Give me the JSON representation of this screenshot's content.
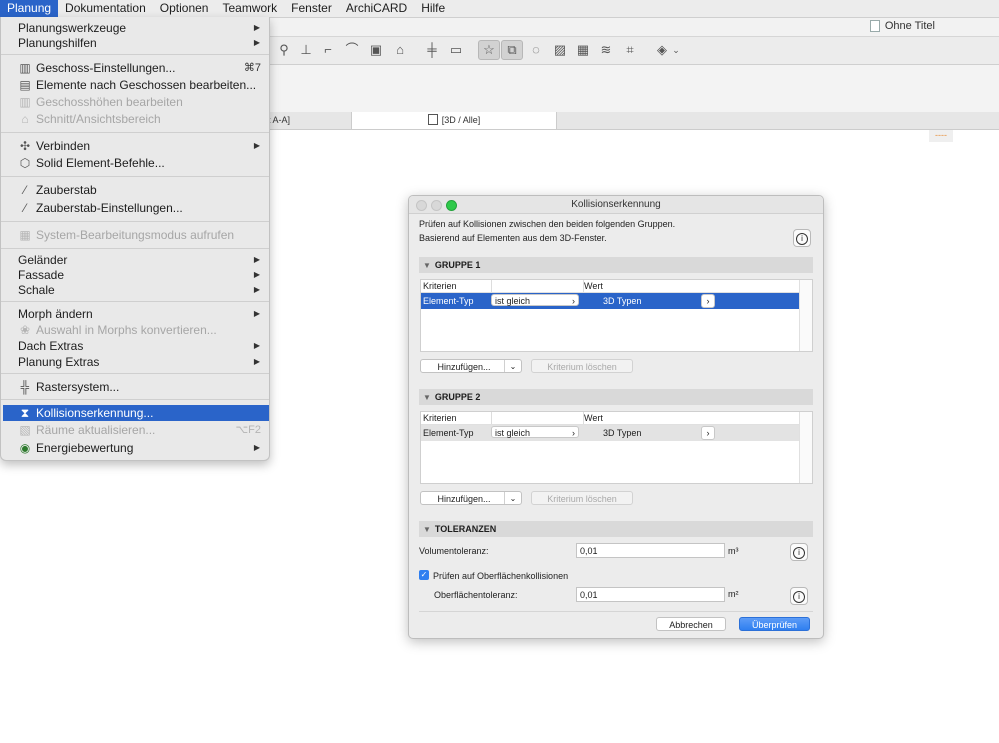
{
  "menubar": {
    "items": [
      "Planung",
      "Dokumentation",
      "Optionen",
      "Teamwork",
      "Fenster",
      "ArchiCARD",
      "Hilfe"
    ],
    "active": "Planung"
  },
  "window": {
    "doc_title": "Ohne Titel"
  },
  "tabs": {
    "inactive": "t A-A]",
    "active": "[3D / Alle]"
  },
  "misc": {
    "orange_dashes": "----"
  },
  "menu": {
    "items": [
      {
        "label": "Planungswerkzeuge",
        "submenu": true
      },
      {
        "label": "Planungshilfen",
        "submenu": true
      },
      {
        "label": "Geschoss-Einstellungen...",
        "shortcut": "⌘7",
        "icon": "building-icon"
      },
      {
        "label": "Elemente nach Geschossen bearbeiten...",
        "icon": "stack-icon"
      },
      {
        "label": "Geschosshöhen bearbeiten",
        "disabled": true,
        "icon": "story-height-icon"
      },
      {
        "label": "Schnitt/Ansichtsbereich",
        "disabled": true,
        "icon": "section-icon"
      },
      {
        "label": "Verbinden",
        "submenu": true,
        "icon": "connect-icon"
      },
      {
        "label": "Solid Element-Befehle...",
        "icon": "solid-icon"
      },
      {
        "label": "Zauberstab",
        "icon": "magic-wand-icon"
      },
      {
        "label": "Zauberstab-Einstellungen...",
        "icon": "magic-wand-settings-icon"
      },
      {
        "label": "System-Bearbeitungsmodus aufrufen",
        "disabled": true,
        "icon": "grid-system-icon"
      },
      {
        "label": "Geländer",
        "submenu": true
      },
      {
        "label": "Fassade",
        "submenu": true
      },
      {
        "label": "Schale",
        "submenu": true
      },
      {
        "label": "Morph ändern",
        "submenu": true
      },
      {
        "label": "Auswahl in Morphs konvertieren...",
        "disabled": true,
        "icon": "morph-icon"
      },
      {
        "label": "Dach Extras",
        "submenu": true
      },
      {
        "label": "Planung Extras",
        "submenu": true
      },
      {
        "label": "Rastersystem...",
        "icon": "grid-icon"
      },
      {
        "label": "Kollisionserkennung...",
        "icon": "collision-icon",
        "highlighted": true
      },
      {
        "label": "Räume aktualisieren...",
        "shortcut": "⌥F2",
        "disabled": true,
        "icon": "zones-icon"
      },
      {
        "label": "Energiebewertung",
        "submenu": true,
        "icon": "globe-icon"
      }
    ]
  },
  "dialog": {
    "title": "Kollisionserkennung",
    "description_line1": "Prüfen auf Kollisionen zwischen den beiden folgenden Gruppen.",
    "description_line2": "Basierend auf Elementen aus dem 3D-Fenster.",
    "group1": {
      "title": "GRUPPE 1",
      "col_criteria": "Kriterien",
      "col_value": "Wert",
      "row": {
        "criterion": "Element-Typ",
        "operator": "ist gleich",
        "value": "3D Typen"
      },
      "add_button": "Hinzufügen...",
      "delete_button": "Kriterium löschen"
    },
    "group2": {
      "title": "GRUPPE 2",
      "col_criteria": "Kriterien",
      "col_value": "Wert",
      "row": {
        "criterion": "Element-Typ",
        "operator": "ist gleich",
        "value": "3D Typen"
      },
      "add_button": "Hinzufügen...",
      "delete_button": "Kriterium löschen"
    },
    "tolerances": {
      "title": "TOLERANZEN",
      "volume_label": "Volumentoleranz:",
      "volume_value": "0,01",
      "volume_unit": "m³",
      "surface_check_label": "Prüfen auf Oberflächenkollisionen",
      "surface_check_checked": true,
      "surface_label": "Oberflächentoleranz:",
      "surface_value": "0,01",
      "surface_unit": "m²"
    },
    "cancel_button": "Abbrechen",
    "check_button": "Überprüfen"
  },
  "colors": {
    "selection": "#2a64c9",
    "primary_button": "#2f7ff0",
    "zoom_light": "#2ec94a",
    "orange_marker": "#e8903a"
  }
}
